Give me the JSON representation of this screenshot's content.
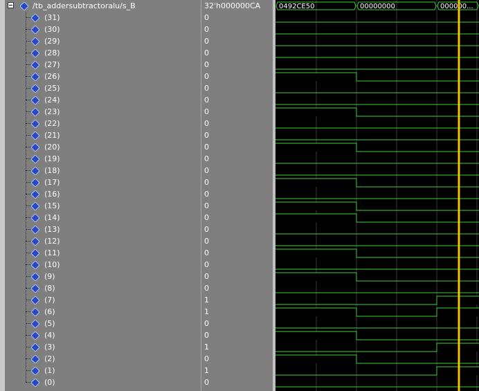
{
  "parent": {
    "name": "/tb_addersubtractoralu/s_B",
    "value": "32'h000000CA",
    "segments": [
      "0492CE50",
      "00000000",
      "000000..."
    ]
  },
  "bits": [
    {
      "label": "(31)",
      "value": "0",
      "levels": [
        0,
        0,
        0
      ]
    },
    {
      "label": "(30)",
      "value": "0",
      "levels": [
        0,
        0,
        0
      ]
    },
    {
      "label": "(29)",
      "value": "0",
      "levels": [
        0,
        0,
        0
      ]
    },
    {
      "label": "(28)",
      "value": "0",
      "levels": [
        0,
        0,
        0
      ]
    },
    {
      "label": "(27)",
      "value": "0",
      "levels": [
        0,
        0,
        0
      ]
    },
    {
      "label": "(26)",
      "value": "0",
      "levels": [
        1,
        0,
        0
      ]
    },
    {
      "label": "(25)",
      "value": "0",
      "levels": [
        0,
        0,
        0
      ]
    },
    {
      "label": "(24)",
      "value": "0",
      "levels": [
        0,
        0,
        0
      ]
    },
    {
      "label": "(23)",
      "value": "0",
      "levels": [
        1,
        0,
        0
      ]
    },
    {
      "label": "(22)",
      "value": "0",
      "levels": [
        0,
        0,
        0
      ]
    },
    {
      "label": "(21)",
      "value": "0",
      "levels": [
        0,
        0,
        0
      ]
    },
    {
      "label": "(20)",
      "value": "0",
      "levels": [
        1,
        0,
        0
      ]
    },
    {
      "label": "(19)",
      "value": "0",
      "levels": [
        0,
        0,
        0
      ]
    },
    {
      "label": "(18)",
      "value": "0",
      "levels": [
        0,
        0,
        0
      ]
    },
    {
      "label": "(17)",
      "value": "0",
      "levels": [
        1,
        0,
        0
      ]
    },
    {
      "label": "(16)",
      "value": "0",
      "levels": [
        0,
        0,
        0
      ]
    },
    {
      "label": "(15)",
      "value": "0",
      "levels": [
        1,
        0,
        0
      ]
    },
    {
      "label": "(14)",
      "value": "0",
      "levels": [
        1,
        0,
        0
      ]
    },
    {
      "label": "(13)",
      "value": "0",
      "levels": [
        0,
        0,
        0
      ]
    },
    {
      "label": "(12)",
      "value": "0",
      "levels": [
        0,
        0,
        0
      ]
    },
    {
      "label": "(11)",
      "value": "0",
      "levels": [
        1,
        0,
        0
      ]
    },
    {
      "label": "(10)",
      "value": "0",
      "levels": [
        0,
        0,
        0
      ]
    },
    {
      "label": "(9)",
      "value": "0",
      "levels": [
        1,
        0,
        0
      ]
    },
    {
      "label": "(8)",
      "value": "0",
      "levels": [
        0,
        0,
        0
      ]
    },
    {
      "label": "(7)",
      "value": "1",
      "levels": [
        0,
        0,
        1
      ]
    },
    {
      "label": "(6)",
      "value": "1",
      "levels": [
        1,
        0,
        1
      ]
    },
    {
      "label": "(5)",
      "value": "0",
      "levels": [
        0,
        0,
        0
      ]
    },
    {
      "label": "(4)",
      "value": "0",
      "levels": [
        1,
        0,
        0
      ]
    },
    {
      "label": "(3)",
      "value": "1",
      "levels": [
        0,
        0,
        1
      ]
    },
    {
      "label": "(2)",
      "value": "0",
      "levels": [
        1,
        0,
        0
      ]
    },
    {
      "label": "(1)",
      "value": "1",
      "levels": [
        0,
        0,
        1
      ]
    },
    {
      "label": "(0)",
      "value": "0",
      "levels": [
        0,
        0,
        0
      ]
    }
  ],
  "colors": {
    "wave": "#3cd23c",
    "cursor": "#f5c400",
    "grid": "#3a3a3a",
    "diamond": "#2848c8"
  },
  "icons": {
    "signal": "diamond-icon",
    "expander": "collapse-minus-icon"
  }
}
